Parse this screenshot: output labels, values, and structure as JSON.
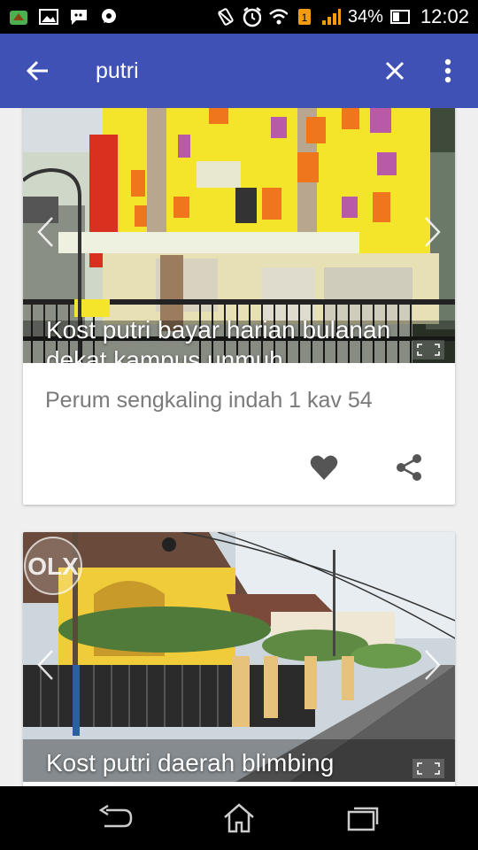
{
  "status_bar": {
    "battery_percent": "34%",
    "time": "12:02",
    "icons": [
      "notification-icon",
      "gallery-icon",
      "bbm-icon",
      "chat-icon",
      "mute-icon",
      "alarm-icon",
      "wifi-icon",
      "sim-icon",
      "signal-icon",
      "battery-icon"
    ]
  },
  "app_bar": {
    "query": "putri",
    "color": "#3f51b5",
    "back_icon": "arrow-left-icon",
    "clear_icon": "close-icon",
    "menu_icon": "more-vert-icon"
  },
  "listings": [
    {
      "title_line1": "Kost putri bayar harian bulanan",
      "title_line2": "dekat kampus unmuh",
      "address": "Perum sengkaling indah 1 kav 54",
      "actions": [
        "heart-icon",
        "share-icon"
      ]
    },
    {
      "title_line1": "Kost putri daerah blimbing",
      "watermark": "OLX"
    }
  ],
  "nav_bar": {
    "icons": [
      "back-icon",
      "home-icon",
      "recent-apps-icon"
    ]
  }
}
